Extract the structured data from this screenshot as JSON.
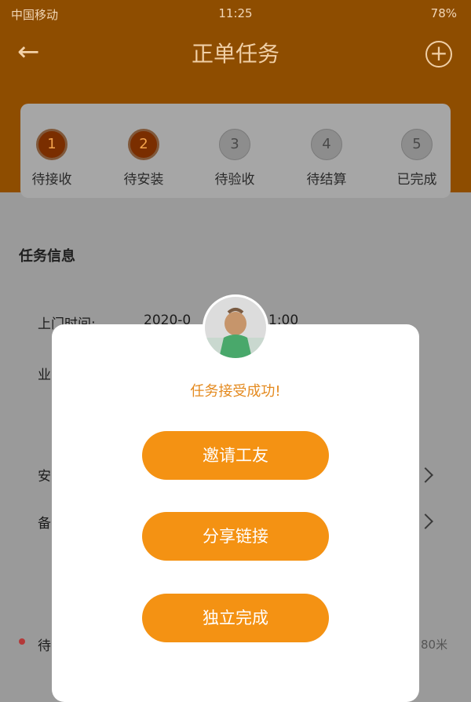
{
  "status": {
    "carrier": "中国移动",
    "time": "11:25",
    "battery": "78%"
  },
  "header": {
    "title": "正单任务",
    "back_icon": "back-arrow-icon",
    "add_icon": "plus-circle-icon",
    "bg_color": "#8e4d00"
  },
  "steps": [
    {
      "num": "1",
      "label": "待接收",
      "active": true
    },
    {
      "num": "2",
      "label": "待安装",
      "active": true
    },
    {
      "num": "3",
      "label": "待验收",
      "active": false
    },
    {
      "num": "4",
      "label": "待结算",
      "active": false
    },
    {
      "num": "5",
      "label": "已完成",
      "active": false
    }
  ],
  "section": {
    "title": "任务信息"
  },
  "background_fields": {
    "visit_time_label": "上门时间:",
    "visit_time_value": "2020-0",
    "visit_time_tail": "1:00",
    "row2_char": "业",
    "row3_char": "安",
    "row4_char": "备",
    "row5_char": "待",
    "distance_tail": "80米"
  },
  "modal": {
    "message": "任务接受成功!",
    "buttons": [
      "邀请工友",
      "分享链接",
      "独立完成"
    ],
    "accent": "#f49213",
    "avatar": "user-avatar"
  }
}
